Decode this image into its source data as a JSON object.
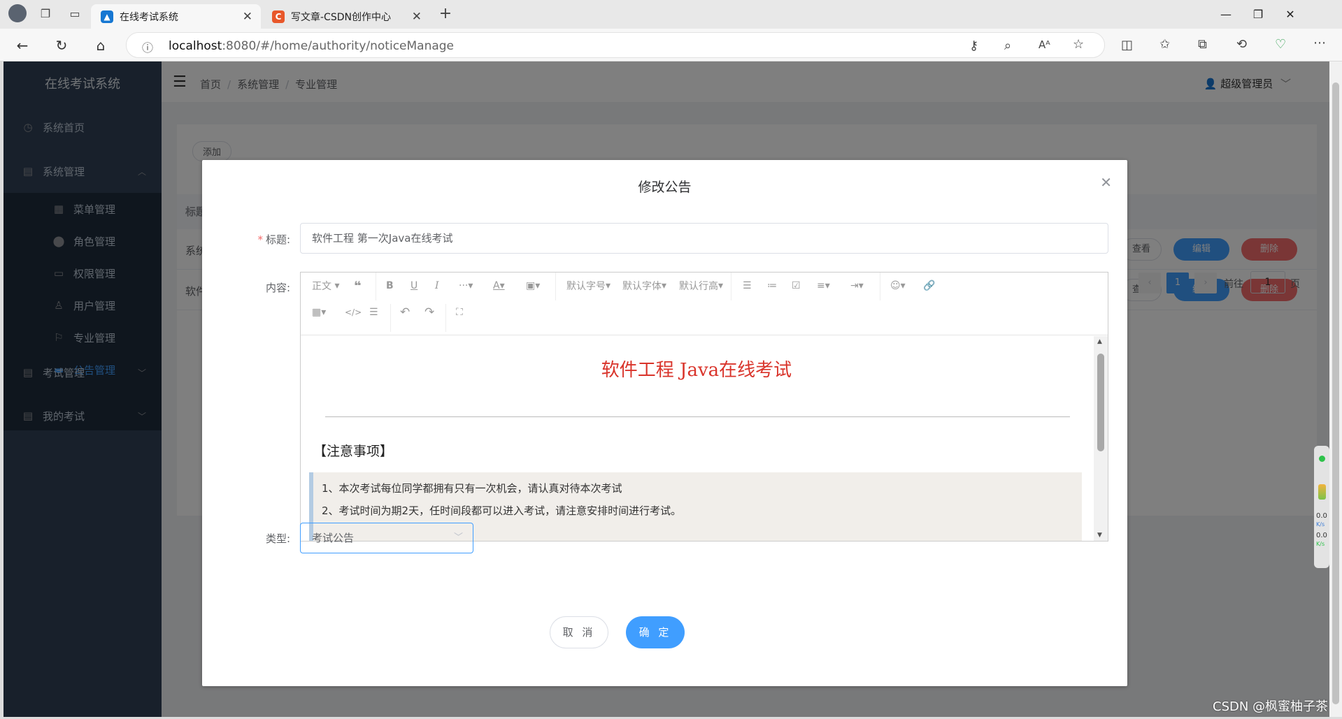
{
  "browser": {
    "tabs": [
      {
        "label": "在线考试系统",
        "active": true
      },
      {
        "label": "写文章-CSDN创作中心",
        "active": false
      }
    ],
    "url_host": "localhost",
    "url_rest": ":8080/#/home/authority/noticeManage"
  },
  "sidebar": {
    "brand": "在线考试系统",
    "items": [
      {
        "label": "系统首页",
        "icon": "clock-icon"
      },
      {
        "label": "系统管理",
        "icon": "list-icon",
        "expanded": true
      },
      {
        "label": "考试管理",
        "icon": "document-icon"
      },
      {
        "label": "我的考试",
        "icon": "document-icon"
      }
    ],
    "subitems": [
      {
        "label": "菜单管理",
        "icon": "grid-icon"
      },
      {
        "label": "角色管理",
        "icon": "person-icon"
      },
      {
        "label": "权限管理",
        "icon": "card-icon"
      },
      {
        "label": "用户管理",
        "icon": "user-icon"
      },
      {
        "label": "专业管理",
        "icon": "flag-icon"
      },
      {
        "label": "公告管理",
        "icon": "chat-icon",
        "active": true
      }
    ]
  },
  "header": {
    "breadcrumb": [
      "首页",
      "系统管理",
      "专业管理"
    ],
    "user": "超级管理员"
  },
  "page": {
    "add_label": "添加",
    "col_title": "标题",
    "rows": [
      {
        "title": "系统",
        "view": "查看",
        "edit": "编辑",
        "delete": "删除"
      },
      {
        "title": "软件",
        "view": "查看",
        "edit": "编辑",
        "delete": "删除"
      }
    ],
    "pager": {
      "current": "1",
      "goto_label": "前往",
      "goto_value": "1",
      "page_suffix": "页"
    }
  },
  "dialog": {
    "title": "修改公告",
    "title_label": "标题:",
    "title_value": "软件工程 第一次Java在线考试",
    "content_label": "内容:",
    "type_label": "类型:",
    "type_value": "考试公告",
    "cancel": "取 消",
    "confirm": "确 定",
    "toolbar": {
      "heading": "正文",
      "font_size": "默认字号",
      "font_family": "默认字体",
      "line_height": "默认行高"
    },
    "editor": {
      "heading": "软件工程 Java在线考试",
      "notice_title": "【注意事项】",
      "lines": [
        "1、本次考试每位同学都拥有只有一次机会，请认真对待本次考试",
        "2、考试时间为期2天，任时间段都可以进入考试，请注意安排时间进行考试。"
      ]
    }
  },
  "netmon": {
    "up": "0.0",
    "down": "0.0",
    "unit": "K/s"
  },
  "watermark": "CSDN @枫蜜柚子茶"
}
